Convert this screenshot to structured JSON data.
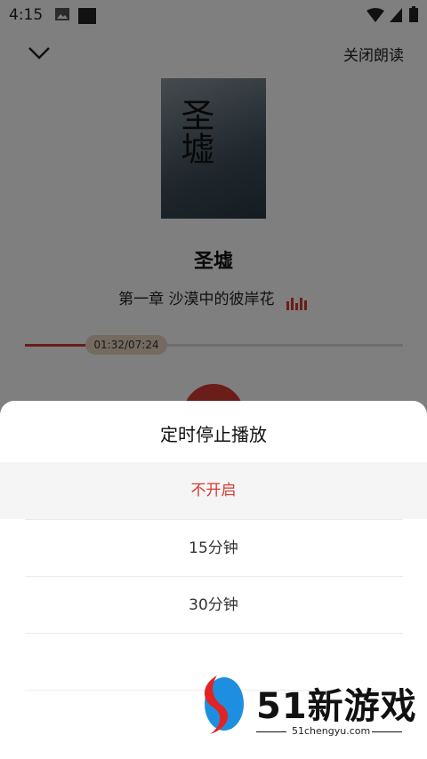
{
  "status_bar": {
    "time": "4:15"
  },
  "header": {
    "close_label": "关闭朗读"
  },
  "book": {
    "title": "圣墟",
    "cover_text": "圣墟",
    "chapter": "第一章 沙漠中的彼岸花"
  },
  "player": {
    "time_display": "01:32/07:24",
    "progress": 0.207
  },
  "sheet": {
    "title": "定时停止播放",
    "options": [
      {
        "label": "不开启",
        "selected": true
      },
      {
        "label": "15分钟"
      },
      {
        "label": "30分钟"
      },
      {
        "label": ""
      }
    ]
  },
  "watermark": {
    "brand": "51新游戏",
    "url": "51chengyu.com"
  },
  "colors": {
    "accent": "#d43b33",
    "timepill_bg": "#e8d4c0"
  }
}
